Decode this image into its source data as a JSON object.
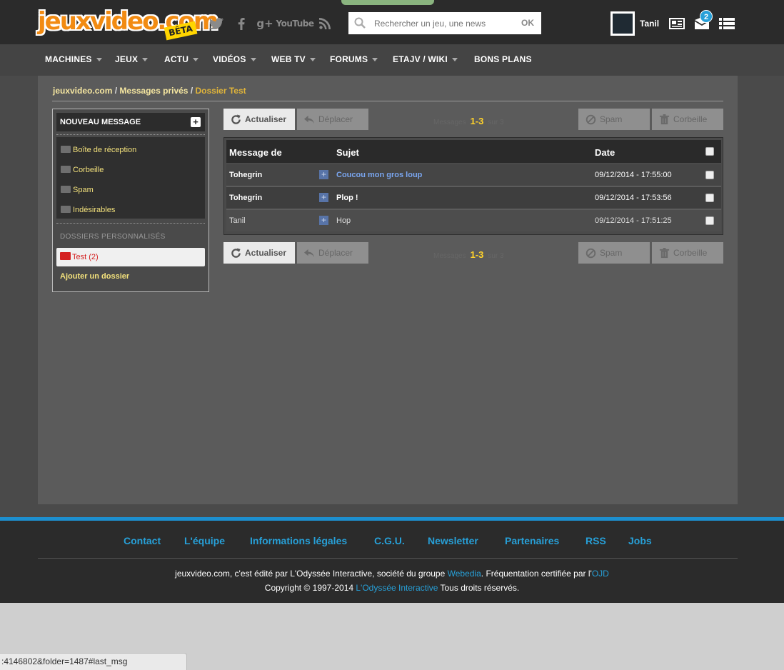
{
  "header": {
    "logo_text": "jeuxvideo.com",
    "logo_badge": "BÊTA",
    "social": [
      "twitter",
      "facebook",
      "google-plus",
      "youtube",
      "rss"
    ],
    "social_youtube_label": "YouTube",
    "search_placeholder": "Rechercher un jeu, une news",
    "search_button": "OK",
    "username": "Tanil",
    "notification_count": "2"
  },
  "nav": {
    "items": [
      "MACHINES",
      "JEUX",
      "ACTU",
      "VIDÉOS",
      "WEB TV",
      "FORUMS",
      "ETAJV / WIKI",
      "BONS PLANS"
    ]
  },
  "breadcrumb": {
    "root": "jeuxvideo.com",
    "section": "Messages privés",
    "current": "Dossier Test",
    "separator": "/"
  },
  "sidebar": {
    "new_message": "NOUVEAU MESSAGE",
    "folders": [
      "Boîte de réception",
      "Corbeille",
      "Spam",
      "Indésirables"
    ],
    "custom_label": "DOSSIERS PERSONNALISÉS",
    "custom_folder": "Test (2)",
    "add_folder": "Ajouter un dossier"
  },
  "toolbar": {
    "refresh": "Actualiser",
    "move": "Déplacer",
    "spam": "Spam",
    "trash": "Corbeille",
    "pager_prefix": "Messages",
    "pager_range": "1-3",
    "pager_suffix": "sur 3"
  },
  "table": {
    "headers": {
      "from": "Message de",
      "subject": "Sujet",
      "date": "Date"
    },
    "rows": [
      {
        "from": "Tohegrin",
        "subject": "Coucou mon gros loup",
        "date": "09/12/2014 - 17:55:00",
        "unread": true
      },
      {
        "from": "Tohegrin",
        "subject": "Plop !",
        "date": "09/12/2014 - 17:53:56",
        "unread": true
      },
      {
        "from": "Tanil",
        "subject": "Hop",
        "date": "09/12/2014 - 17:51:25",
        "unread": false
      }
    ]
  },
  "footer": {
    "links": [
      "Contact",
      "L'équipe",
      "Informations légales",
      "C.G.U.",
      "Newsletter",
      "Partenaires",
      "RSS",
      "Jobs"
    ],
    "line1_pre": "jeuxvideo.com, c'est édité par L'Odyssée Interactive, société du groupe ",
    "line1_webedia": "Webedia",
    "line1_mid": ". Fréquentation certifiée par l'",
    "line1_ojd": "OJD",
    "line2_pre": "Copyright © 1997-2014 ",
    "line2_link": "L'Odyssée Interactive",
    "line2_post": " Tous droits réservés."
  },
  "status_bar": ":4146802&folder=1487#last_msg",
  "colors": {
    "accent_blue": "#27a0d8",
    "logo_orange": "#f28b12",
    "folder_yellow": "#f4e27c",
    "active_red": "#d42020",
    "pager_yellow": "#ffd22b",
    "unread_subject_blue": "#7aa6f0"
  }
}
